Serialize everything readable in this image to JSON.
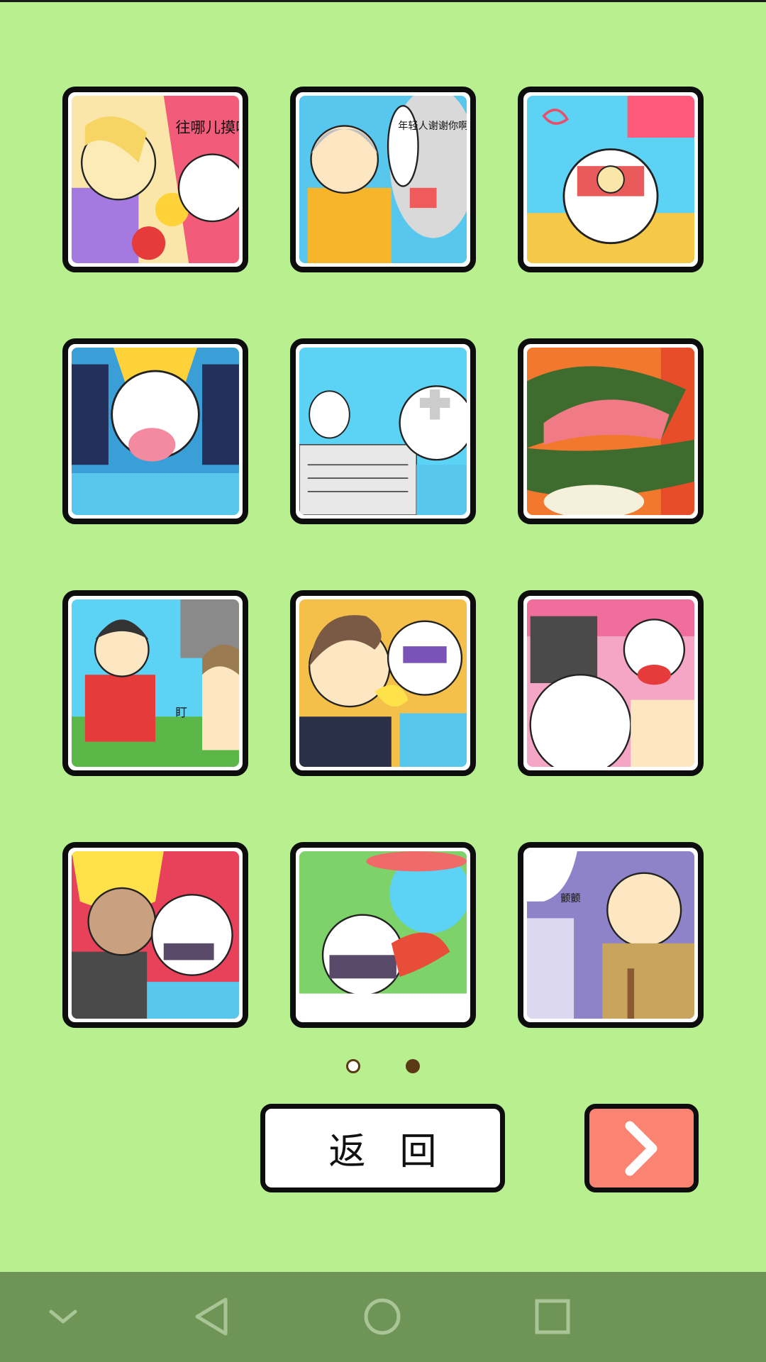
{
  "level_grid": {
    "tiles": [
      {
        "id": "comic-1",
        "speech_text": "往哪儿摸呢你这色狼!!"
      },
      {
        "id": "comic-2",
        "speech_text": "年轻人谢谢你啊"
      },
      {
        "id": "comic-3"
      },
      {
        "id": "comic-4"
      },
      {
        "id": "comic-5"
      },
      {
        "id": "comic-6"
      },
      {
        "id": "comic-7",
        "speech_text": "盯"
      },
      {
        "id": "comic-8"
      },
      {
        "id": "comic-9"
      },
      {
        "id": "comic-10"
      },
      {
        "id": "comic-11"
      },
      {
        "id": "comic-12",
        "speech_text": "颤颤"
      }
    ]
  },
  "pager": {
    "page_count": 2,
    "current_page": 2
  },
  "buttons": {
    "back_label": "返回",
    "next_icon": "chevron-right-icon"
  },
  "system_nav": {
    "items": [
      "collapse-icon",
      "back-triangle-icon",
      "home-circle-icon",
      "recents-square-icon"
    ]
  },
  "colors": {
    "background": "#b8f090",
    "next_button": "#fb8371",
    "nav_bar": "#6e9556",
    "pager_dot": "#5a3a14"
  }
}
